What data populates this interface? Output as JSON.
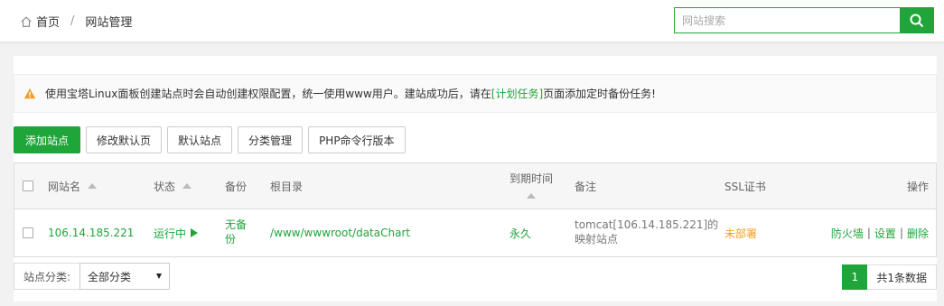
{
  "breadcrumb": {
    "home": "首页",
    "separator": "/",
    "current": "网站管理"
  },
  "search": {
    "placeholder": "网站搜索"
  },
  "notice": {
    "text_before": "使用宝塔Linux面板创建站点时会自动创建权限配置，统一使用www用户。建站成功后，请在",
    "link": "[计划任务]",
    "text_after": "页面添加定时备份任务!"
  },
  "toolbar": {
    "add_site": "添加站点",
    "edit_default_page": "修改默认页",
    "default_site": "默认站点",
    "category_manage": "分类管理",
    "php_version": "PHP命令行版本"
  },
  "table": {
    "headers": {
      "name": "网站名",
      "status": "状态",
      "backup": "备份",
      "root": "根目录",
      "expire": "到期时间",
      "remark": "备注",
      "ssl": "SSL证书",
      "actions": "操作"
    },
    "rows": [
      {
        "name": "106.14.185.221",
        "status": "运行中",
        "backup_line1": "无备",
        "backup_line2": "份",
        "root": "/www/wwwroot/dataChart",
        "expire": "永久",
        "remark_line1": "tomcat[106.14.185.221]的",
        "remark_line2": "映射站点",
        "ssl": "未部署",
        "action_firewall": "防火墙",
        "action_settings": "设置",
        "action_delete": "删除",
        "action_sep": "|"
      }
    ]
  },
  "footer": {
    "category_label": "站点分类:",
    "category_value": "全部分类",
    "page": "1",
    "total": "共1条数据"
  },
  "colors": {
    "accent": "#20a53a",
    "warning": "#f0a020"
  }
}
